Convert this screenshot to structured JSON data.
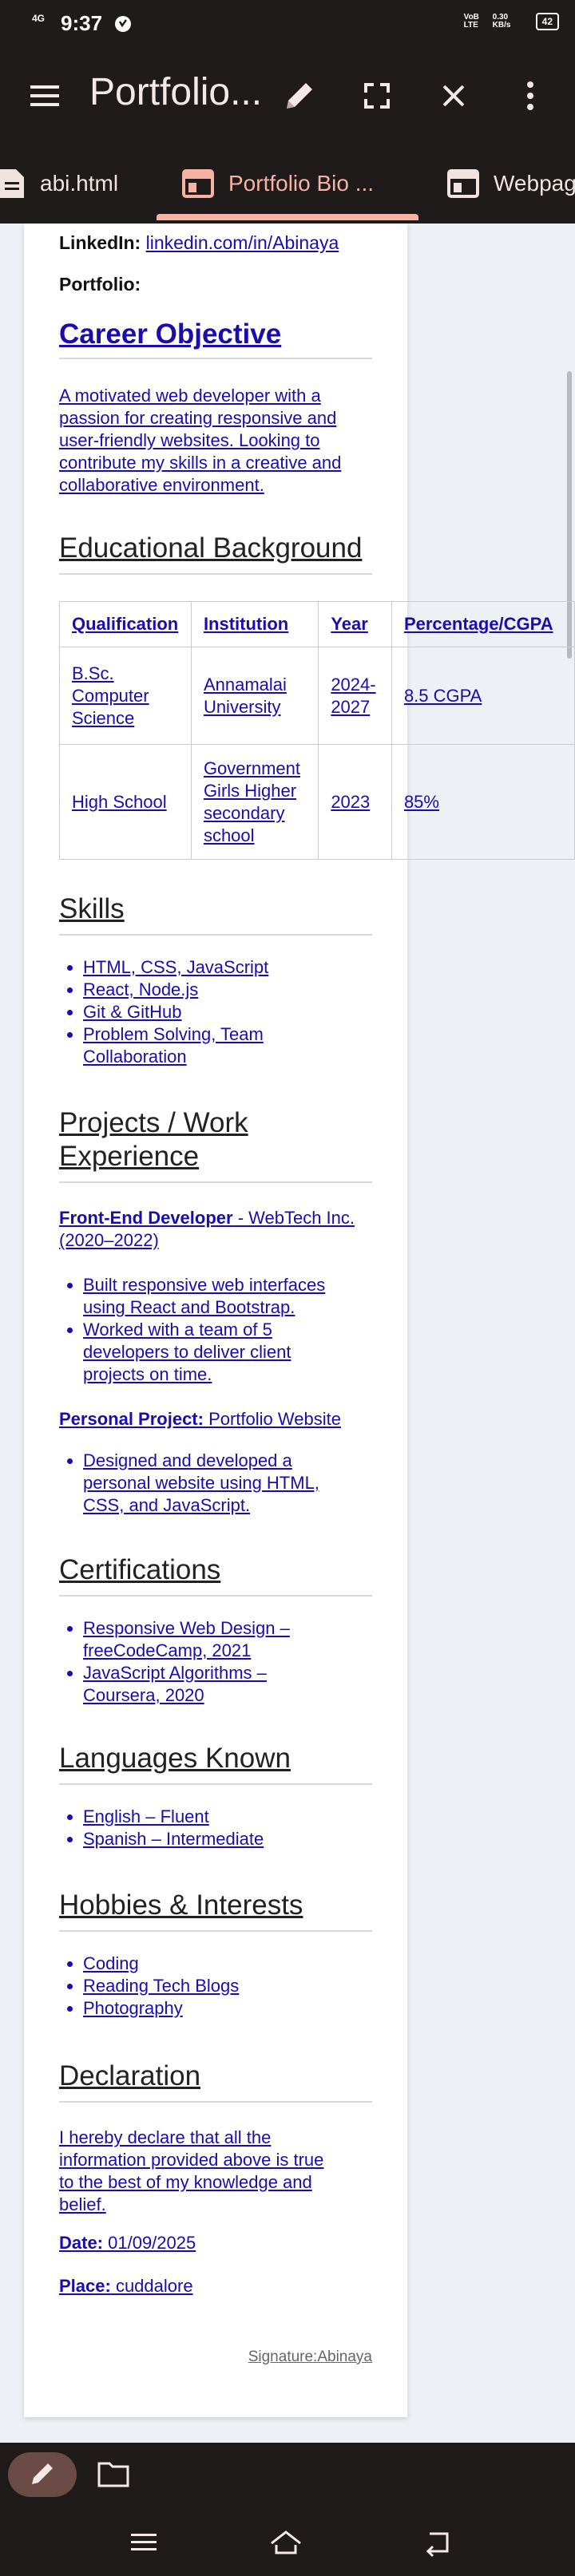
{
  "status_bar": {
    "network": "4G",
    "time": "9:37",
    "volte": "VoB LTE",
    "speed": "0.30 KB/s",
    "battery": "42"
  },
  "app_bar": {
    "title": "Portfolio..."
  },
  "tabs": [
    {
      "label": "abi.html",
      "icon": "document-icon",
      "active": false
    },
    {
      "label": "Portfolio Bio ...",
      "icon": "web-page-icon",
      "active": true
    },
    {
      "label": "Webpag",
      "icon": "web-page-icon",
      "active": false
    }
  ],
  "page": {
    "linkedin_label": "LinkedIn:",
    "linkedin_link": "linkedin.com/in/Abinaya",
    "portfolio_label": "Portfolio:",
    "career": {
      "heading": "Career Objective",
      "lines": [
        "A motivated web developer with a",
        "passion for creating responsive and",
        "user-friendly websites. Looking to",
        "contribute my skills in a creative and",
        "collaborative environment."
      ]
    },
    "education": {
      "heading": "Educational Background",
      "columns": [
        "Qualification",
        "Institution",
        "Year",
        "Percentage/CGPA"
      ],
      "rows": [
        {
          "qualification": [
            "B.Sc.",
            "Computer",
            "Science"
          ],
          "institution": [
            "Annamalai",
            "University"
          ],
          "year": [
            "2024-",
            "2027"
          ],
          "score": "8.5 CGPA"
        },
        {
          "qualification": [
            "High School"
          ],
          "institution": [
            "Government",
            "Girls Higher",
            "secondary",
            "school"
          ],
          "year": [
            "2023"
          ],
          "score": "85%"
        }
      ]
    },
    "skills": {
      "heading": "Skills",
      "items": [
        "HTML, CSS, JavaScript",
        "React, Node.js",
        "Git & GitHub",
        "Problem Solving, Team",
        "Collaboration"
      ]
    },
    "projects": {
      "heading_line1": "Projects / Work",
      "heading_line2": "Experience",
      "job_title": "Front-End Developer",
      "job_company_line1": " - WebTech Inc.",
      "job_company_line2": "(2020–2022)",
      "job_items": [
        [
          "Built responsive web interfaces",
          "using React and Bootstrap."
        ],
        [
          "Worked with a team of 5",
          "developers to deliver client",
          "projects on time."
        ]
      ],
      "personal_label": "Personal Project:",
      "personal_value": " Portfolio Website",
      "personal_items": [
        [
          "Designed and developed a",
          "personal website using HTML,",
          "CSS, and JavaScript."
        ]
      ]
    },
    "certifications": {
      "heading": "Certifications",
      "items": [
        [
          "Responsive Web Design –",
          "freeCodeCamp, 2021"
        ],
        [
          "JavaScript Algorithms –",
          "Coursera, 2020"
        ]
      ]
    },
    "languages": {
      "heading": "Languages Known",
      "items": [
        "English – Fluent",
        "Spanish – Intermediate"
      ]
    },
    "hobbies": {
      "heading": "Hobbies & Interests",
      "items": [
        "Coding",
        "Reading Tech Blogs",
        "Photography"
      ]
    },
    "declaration": {
      "heading": "Declaration",
      "lines": [
        "I hereby declare that all the",
        "information provided above is true",
        "to the best of my knowledge and",
        "belief."
      ],
      "date_label": "Date:",
      "date_value": " 01/09/2025",
      "place_label": "Place:",
      "place_value": " cuddalore",
      "signature": "Signature:Abinaya"
    }
  },
  "colors": {
    "bar_bg": "#1f1b1a",
    "accent": "#f6b3a4",
    "link": "#1a0dab"
  }
}
